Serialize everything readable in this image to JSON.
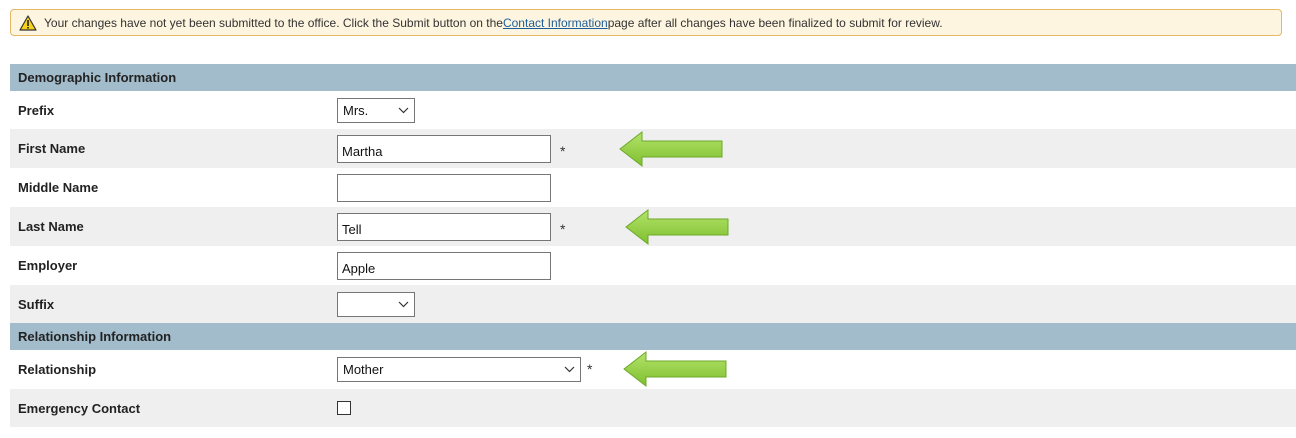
{
  "notice": {
    "text_before": "Your changes have not yet been submitted to the office. Click the Submit button on the ",
    "link_text": "Contact Information",
    "text_after": " page after all changes have been finalized to submit for review."
  },
  "sections": {
    "demographic": {
      "title": "Demographic Information"
    },
    "relationship": {
      "title": "Relationship Information"
    }
  },
  "fields": {
    "prefix": {
      "label": "Prefix",
      "value": "Mrs."
    },
    "first_name": {
      "label": "First Name",
      "value": "Martha",
      "required_mark": "*"
    },
    "middle_name": {
      "label": "Middle Name",
      "value": ""
    },
    "last_name": {
      "label": "Last Name",
      "value": "Tell",
      "required_mark": "*"
    },
    "employer": {
      "label": "Employer",
      "value": "Apple"
    },
    "suffix": {
      "label": "Suffix",
      "value": ""
    },
    "relationship": {
      "label": "Relationship",
      "value": "Mother",
      "required_mark": "*"
    },
    "emergency_contact": {
      "label": "Emergency Contact",
      "checked": false
    }
  },
  "colors": {
    "section_header": "#a2bccb",
    "alt_row": "#efefef",
    "notice_bg": "#fdf5df",
    "notice_border": "#e3b867",
    "arrow_green": "#8ccc3a"
  }
}
